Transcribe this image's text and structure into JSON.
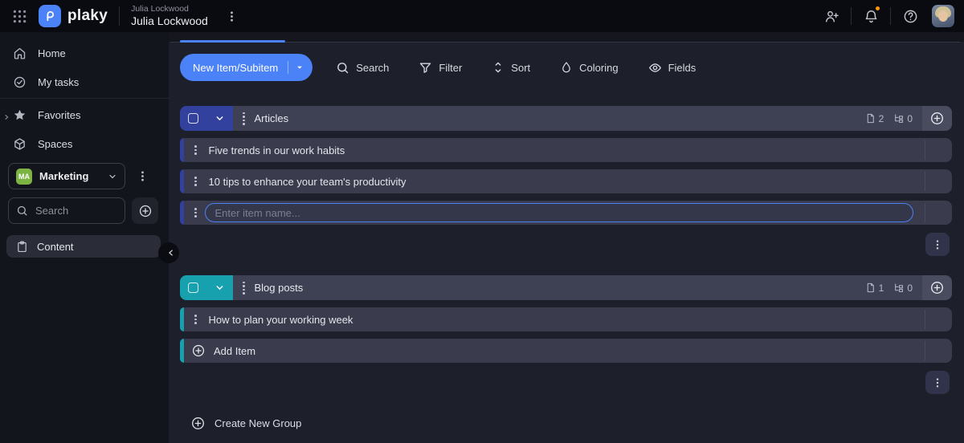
{
  "topbar": {
    "brand": "plaky",
    "workspace_label": "Julia Lockwood",
    "board_title": "Julia Lockwood"
  },
  "sidebar": {
    "home": "Home",
    "my_tasks": "My tasks",
    "favorites": "Favorites",
    "spaces": "Spaces",
    "workspace": {
      "initials": "MA",
      "name": "Marketing",
      "color": "#7cb342"
    },
    "search_placeholder": "Search",
    "board_link": "Content"
  },
  "toolbar": {
    "new_item": "New Item/Subitem",
    "actions": [
      {
        "label": "Search",
        "icon": "search-icon"
      },
      {
        "label": "Filter",
        "icon": "filter-icon"
      },
      {
        "label": "Sort",
        "icon": "sort-icon"
      },
      {
        "label": "Coloring",
        "icon": "coloring-icon"
      },
      {
        "label": "Fields",
        "icon": "fields-icon"
      }
    ]
  },
  "board": {
    "groups": [
      {
        "name": "Articles",
        "color": "#32409e",
        "items_count": "2",
        "subitems_count": "0",
        "items": [
          "Five trends in our work habits",
          "10 tips to enhance your team's productivity"
        ],
        "new_item_placeholder": "Enter item name..."
      },
      {
        "name": "Blog posts",
        "color": "#17a0ae",
        "items_count": "1",
        "subitems_count": "0",
        "items": [
          "How to plan your working week"
        ],
        "add_item": "Add Item"
      }
    ],
    "create_group": "Create New Group"
  },
  "colors": {
    "accent_blue": "#4c82f7",
    "group_articles": "#32409e",
    "group_blog_posts": "#17a0ae",
    "workspace_green": "#7cb342",
    "notification_orange": "#ff9800"
  }
}
